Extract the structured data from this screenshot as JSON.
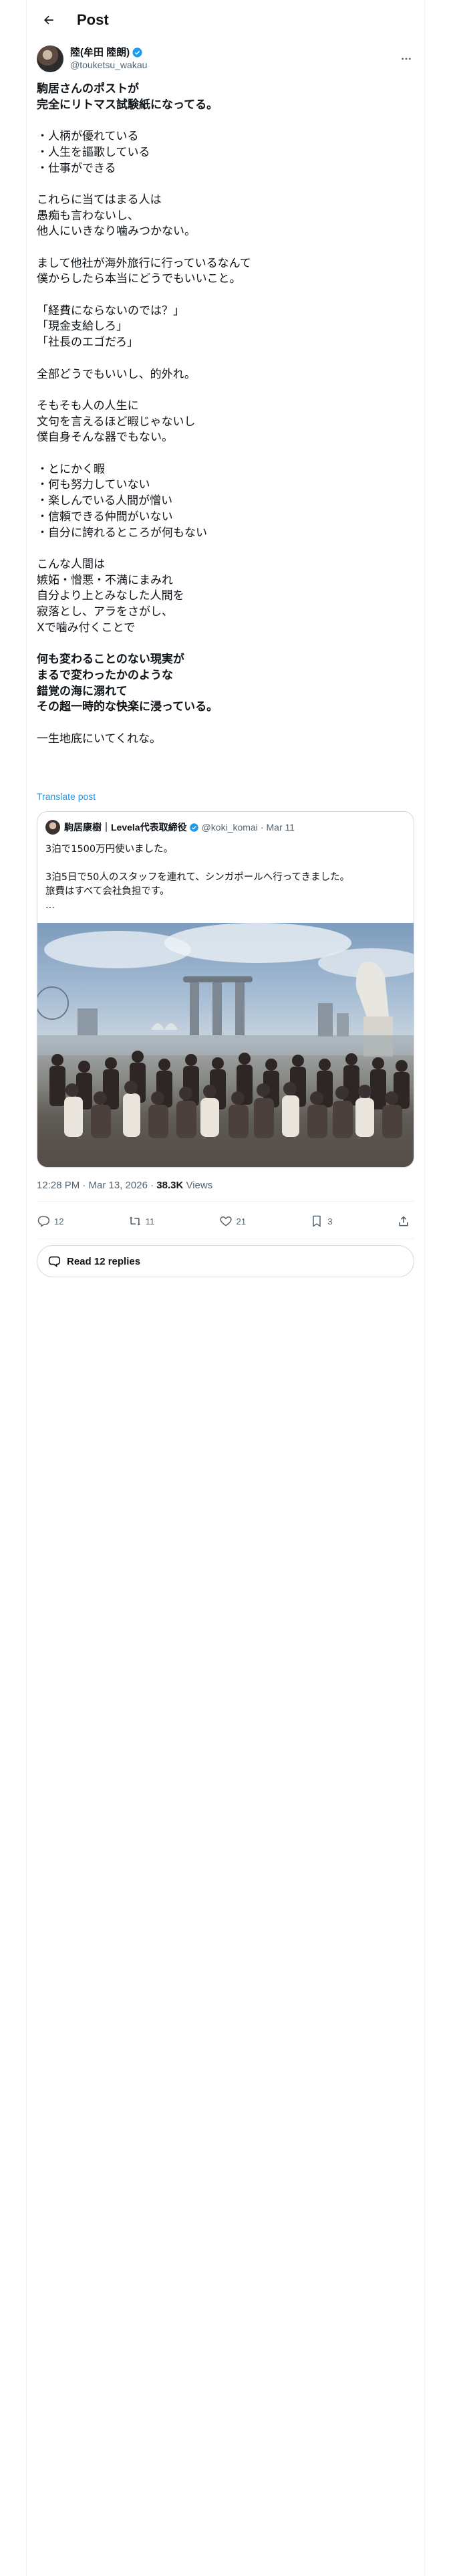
{
  "header": {
    "title": "Post"
  },
  "author": {
    "name": "陸(牟田 陸朗)",
    "handle": "@touketsu_wakau"
  },
  "tweet_lines": [
    {
      "t": "駒居さんのポストが",
      "b": true
    },
    {
      "t": "完全にリトマス試験紙になってる。",
      "b": true
    },
    {
      "t": "",
      "b": false
    },
    {
      "t": "・人柄が優れている",
      "b": false
    },
    {
      "t": "・人生を謳歌している",
      "b": false
    },
    {
      "t": "・仕事ができる",
      "b": false
    },
    {
      "t": "",
      "b": false
    },
    {
      "t": "これらに当てはまる人は",
      "b": false
    },
    {
      "t": "愚痴も言わないし、",
      "b": false
    },
    {
      "t": "他人にいきなり噛みつかない。",
      "b": false
    },
    {
      "t": "",
      "b": false
    },
    {
      "t": "まして他社が海外旅行に行っているなんて",
      "b": false
    },
    {
      "t": "僕からしたら本当にどうでもいいこと。",
      "b": false
    },
    {
      "t": "",
      "b": false
    },
    {
      "t": "「経費にならないのでは？」",
      "b": false
    },
    {
      "t": "「現金支給しろ」",
      "b": false
    },
    {
      "t": "「社長のエゴだろ」",
      "b": false
    },
    {
      "t": "",
      "b": false
    },
    {
      "t": "全部どうでもいいし、的外れ。",
      "b": false
    },
    {
      "t": "",
      "b": false
    },
    {
      "t": "そもそも人の人生に",
      "b": false
    },
    {
      "t": "文句を言えるほど暇じゃないし",
      "b": false
    },
    {
      "t": "僕自身そんな器でもない。",
      "b": false
    },
    {
      "t": "",
      "b": false
    },
    {
      "t": "・とにかく暇",
      "b": false
    },
    {
      "t": "・何も努力していない",
      "b": false
    },
    {
      "t": "・楽しんでいる人間が憎い",
      "b": false
    },
    {
      "t": "・信頼できる仲間がいない",
      "b": false
    },
    {
      "t": "・自分に誇れるところが何もない",
      "b": false
    },
    {
      "t": "",
      "b": false
    },
    {
      "t": "こんな人間は",
      "b": false
    },
    {
      "t": "嫉妬・憎悪・不満にまみれ",
      "b": false
    },
    {
      "t": "自分より上とみなした人間を",
      "b": false
    },
    {
      "t": "寂落とし、アラをさがし、",
      "b": false
    },
    {
      "t": "Xで噛み付くことで",
      "b": false
    },
    {
      "t": "",
      "b": false
    },
    {
      "t": "何も変わることのない現実が",
      "b": true
    },
    {
      "t": "まるで変わったかのような",
      "b": true
    },
    {
      "t": "錯覚の海に溺れて",
      "b": true
    },
    {
      "t": "その超一時的な快楽に浸っている。",
      "b": true
    },
    {
      "t": "",
      "b": false
    },
    {
      "t": "一生地底にいてくれな。",
      "b": false
    }
  ],
  "translate_label": "Translate post",
  "quote": {
    "name": "駒居康樹｜Levela代表取締役",
    "handle": "@koki_komai",
    "date": "Mar 11",
    "lines": [
      "3泊で1500万円使いました。",
      "",
      "3泊5日で50人のスタッフを連れて、シンガポールへ行ってきました。",
      "旅費はすべて会社負担です。",
      "..."
    ]
  },
  "meta": {
    "time": "12:28 PM · Mar 13, 2026 · ",
    "views_count": "38.3K",
    "views_label": " Views"
  },
  "actions": {
    "replies": "12",
    "reposts": "11",
    "likes": "21",
    "bookmarks": "3"
  },
  "read_replies_label": "Read 12 replies",
  "colors": {
    "text": "#0f1419",
    "muted": "#536471",
    "link": "#1d9bf0",
    "border": "#cfd9de"
  }
}
